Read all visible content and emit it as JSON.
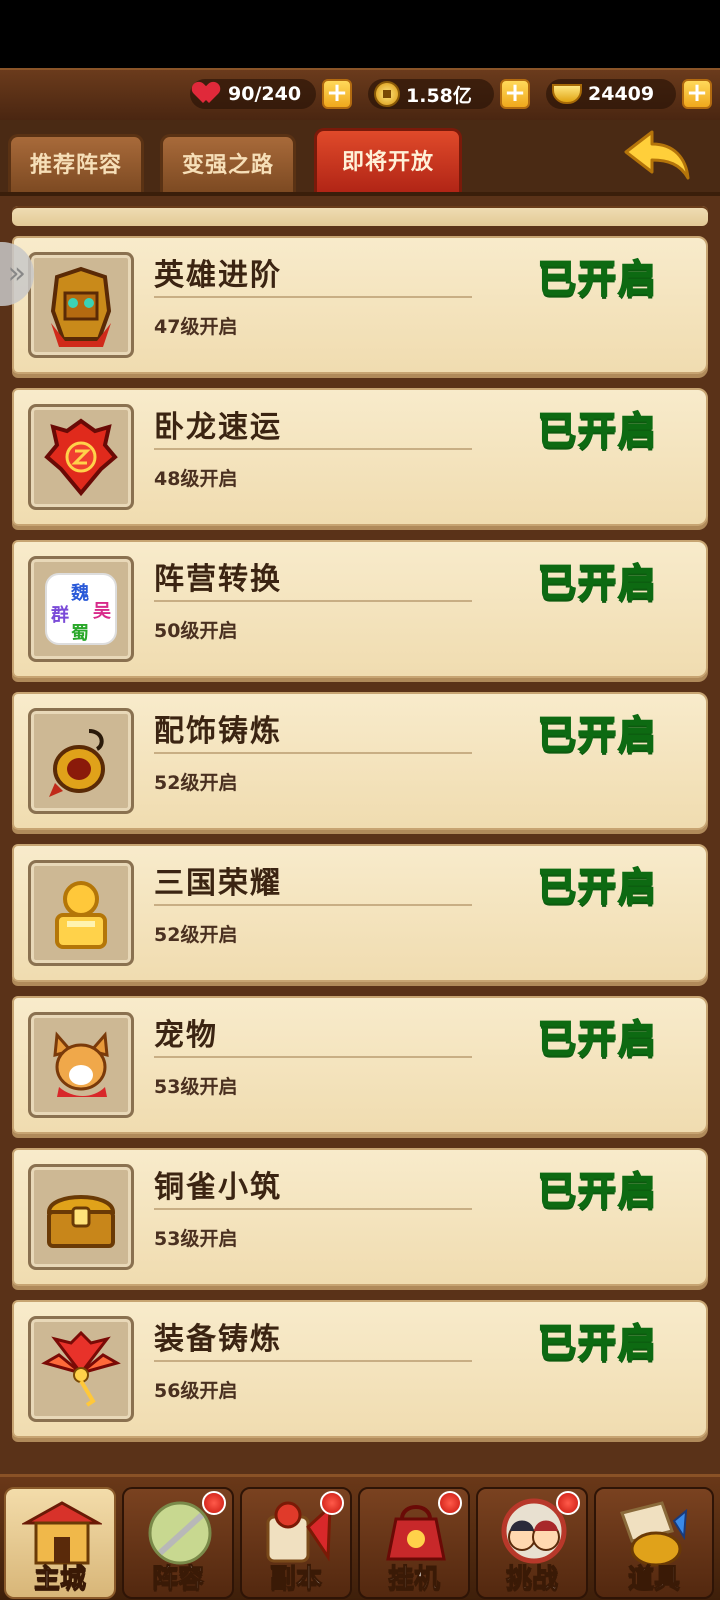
{
  "resources": {
    "stamina": "90/240",
    "copper": "1.58亿",
    "gold": "24409"
  },
  "tabs": [
    {
      "label": "推荐阵容"
    },
    {
      "label": "变强之路"
    },
    {
      "label": "即将开放"
    }
  ],
  "features": [
    {
      "name": "英雄进阶",
      "level": "47级开启",
      "status": "已开启",
      "icon": "lion-mask-icon"
    },
    {
      "name": "卧龙速运",
      "level": "48级开启",
      "status": "已开启",
      "icon": "red-emblem-icon"
    },
    {
      "name": "阵营转换",
      "level": "50级开启",
      "status": "已开启",
      "icon": "faction-icon"
    },
    {
      "name": "配饰铸炼",
      "level": "52级开启",
      "status": "已开启",
      "icon": "dragon-pendant-icon"
    },
    {
      "name": "三国荣耀",
      "level": "52级开启",
      "status": "已开启",
      "icon": "gold-seal-icon"
    },
    {
      "name": "宠物",
      "level": "53级开启",
      "status": "已开启",
      "icon": "corgi-pet-icon"
    },
    {
      "name": "铜雀小筑",
      "level": "53级开启",
      "status": "已开启",
      "icon": "treasure-chest-icon"
    },
    {
      "name": "装备铸炼",
      "level": "56级开启",
      "status": "已开启",
      "icon": "phoenix-feather-icon"
    }
  ],
  "faction_icon_text": [
    "魏",
    "吴",
    "群",
    "蜀"
  ],
  "nav": [
    {
      "label": "主城",
      "icon": "city-gate-icon"
    },
    {
      "label": "阵容",
      "icon": "formation-icon"
    },
    {
      "label": "副本",
      "icon": "dungeon-icon"
    },
    {
      "label": "挂机",
      "icon": "idle-icon"
    },
    {
      "label": "挑战",
      "icon": "challenge-icon"
    },
    {
      "label": "道具",
      "icon": "items-icon"
    }
  ]
}
